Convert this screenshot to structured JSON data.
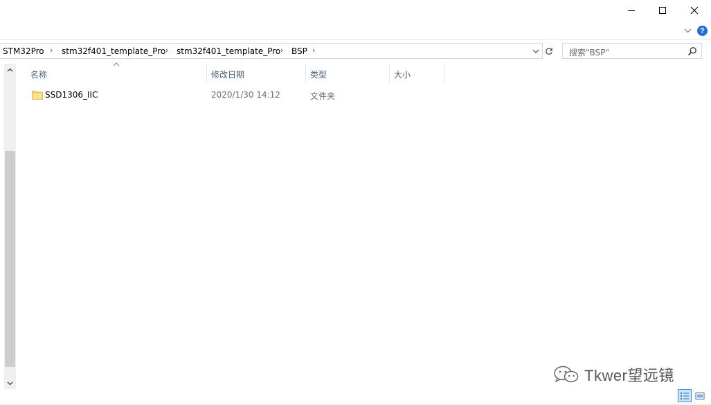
{
  "window": {
    "controls": [
      "minimize",
      "maximize",
      "close"
    ]
  },
  "help": {
    "label": "?"
  },
  "address": {
    "crumbs": [
      "STM32Pro",
      "stm32f401_template_Pro",
      "stm32f401_template_Pro",
      "BSP"
    ],
    "separator": "›"
  },
  "search": {
    "placeholder": "搜索\"BSP\""
  },
  "columns": {
    "name": "名称",
    "modified": "修改日期",
    "type": "类型",
    "size": "大小"
  },
  "rows": [
    {
      "name": "SSD1306_IIC",
      "modified": "2020/1/30 14:12",
      "type": "文件夹",
      "size": ""
    }
  ],
  "watermark": {
    "text": "Tkwer望远镜"
  },
  "colors": {
    "accent": "#1e6fd9",
    "folder": "#f8d775",
    "header_text": "#4c607a"
  }
}
